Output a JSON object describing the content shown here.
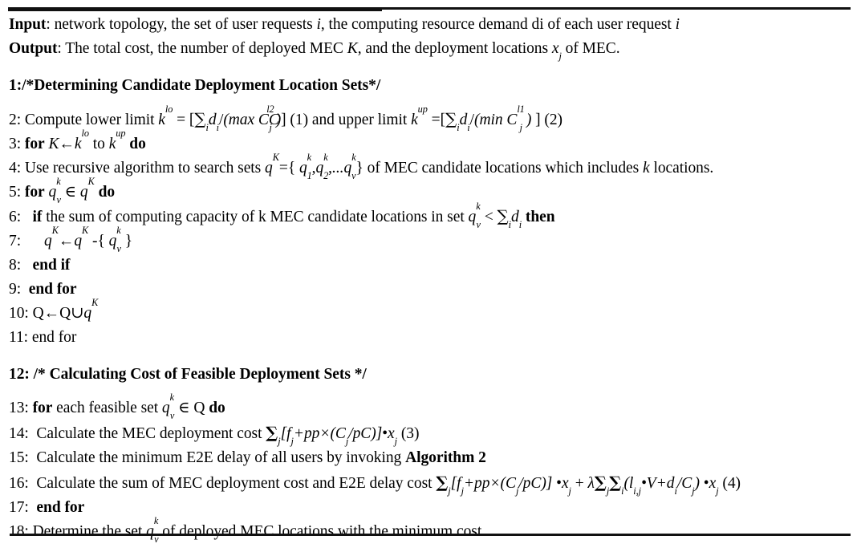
{
  "document": {
    "type": "algorithm-pseudocode",
    "colors": {
      "text": "#000000",
      "background": "#ffffff",
      "rule": "#111111"
    },
    "header": {
      "input_label": "Input",
      "input_text": ": network topology, the set of user requests i, the computing resource demand di of each user request i",
      "output_label": "Output",
      "output_text": ": The total cost, the number of deployed MEC K, and the deployment locations xj of MEC."
    },
    "lines": [
      {
        "num": "1:",
        "text": "/*Determining Candidate Deployment Location Sets*/"
      },
      {
        "num": "2:",
        "text": "Compute lower limit klo = [∑idi/(max Cjl2)] (1) and upper limit kup =[∑idi/(min Cjl1 ) ] (2)"
      },
      {
        "num": "3:",
        "text": "for K←klo to kup do"
      },
      {
        "num": "4:",
        "text": "Use recursive algorithm to search sets qK={ q1k,q2k,...qvk} of MEC candidate locations which includes k locations."
      },
      {
        "num": "5:",
        "text": "for qvk ∈ qK do"
      },
      {
        "num": "6:",
        "text": "if the sum of computing capacity of k MEC candidate locations in set qvk < ∑idi then"
      },
      {
        "num": "7:",
        "text": "qK←qK -{ qvk }"
      },
      {
        "num": "8:",
        "text": "end if"
      },
      {
        "num": "9:",
        "text": "end for"
      },
      {
        "num": "10:",
        "text": "Q←Q∪qK"
      },
      {
        "num": "11:",
        "text": "end for"
      },
      {
        "num": "12:",
        "text": "/* Calculating Cost of Feasible Deployment Sets */"
      },
      {
        "num": "13:",
        "text": "for each feasible set qvk ∈ Q do"
      },
      {
        "num": "14:",
        "text": "Calculate the MEC deployment cost ∑j[fj+pp×(Cj/pC)]•xj (3)"
      },
      {
        "num": "15:",
        "text": "Calculate the minimum E2E delay of all users by invoking Algorithm 2"
      },
      {
        "num": "16:",
        "text": "Calculate the sum of MEC deployment cost and E2E delay cost ∑j[fj+pp×(Cj/pC)] •xj + λ∑j∑i(li,j•V+di/Cj) •xj (4)"
      },
      {
        "num": "17:",
        "text": "end for"
      },
      {
        "num": "18:",
        "text": "Determine the set qvk of deployed MEC locations with the minimum cost"
      }
    ],
    "equation_tags": [
      "(1)",
      "(2)",
      "(3)",
      "(4)"
    ],
    "keywords": [
      "for",
      "do",
      "if",
      "then",
      "end if",
      "end for",
      "Algorithm 2"
    ],
    "symbols": {
      "sum": "∑",
      "element_of": "∈",
      "union": "∪",
      "left_arrow": "←",
      "less_than": "<",
      "lambda": "λ",
      "bullet": "•",
      "times": "×"
    },
    "comment_blocks": [
      "/*Determining Candidate Deployment Location Sets*/",
      "/* Calculating Cost of Feasible Deployment Sets */"
    ]
  }
}
